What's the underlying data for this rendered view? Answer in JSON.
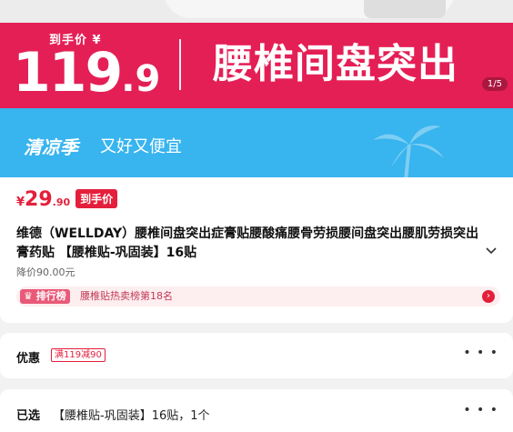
{
  "hero": {
    "label": "到手价 ¥",
    "price_main": "119",
    "price_decimal": ".9",
    "title": "腰椎间盘突出",
    "pager": "1/5"
  },
  "banner": {
    "season": "清凉季",
    "slogan": "又好又便宜"
  },
  "product": {
    "currency": "¥",
    "price_int": "29",
    "price_dec": ".90",
    "price_tag": "到手价",
    "title": "维德（WELLDAY）腰椎间盘突出症膏贴腰酸痛腰骨劳损腰间盘突出腰肌劳损突出膏药贴 【腰椎贴-巩固装】16贴",
    "expand_icon": "chevron-down",
    "original_price": "降价90.00元",
    "rank_badge": "排行榜",
    "rank_text": "腰椎贴热卖榜第18名"
  },
  "discount": {
    "label": "优惠",
    "coupon": "满119减90",
    "more": "• • •"
  },
  "selected": {
    "label": "已选",
    "value": "【腰椎贴-巩固装】16贴，1个",
    "more": "• • •"
  },
  "colors": {
    "hero_bg": "#e41f55",
    "banner_bg": "#38b4ee",
    "accent": "#e41f3b"
  }
}
